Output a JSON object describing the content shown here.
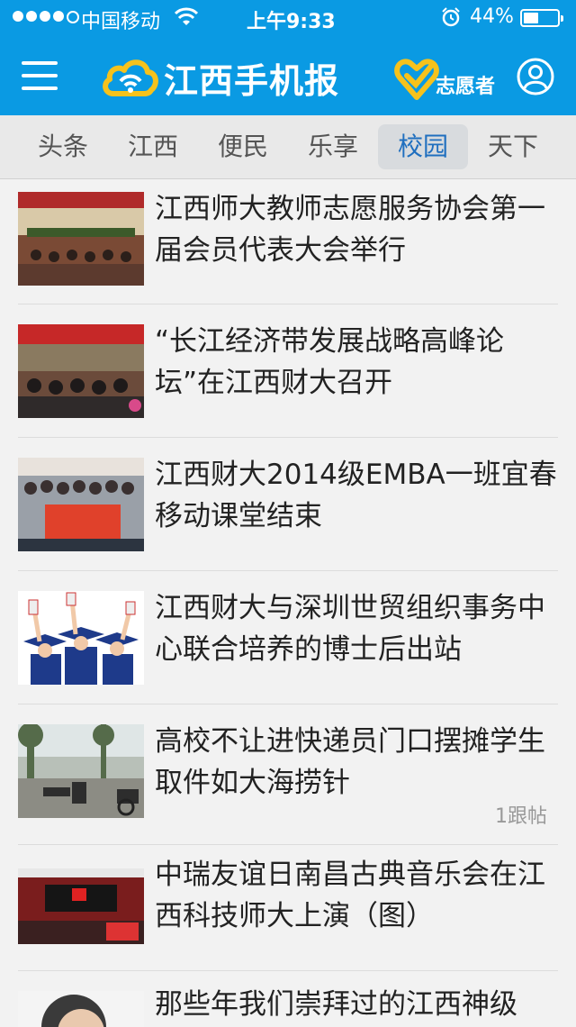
{
  "status_bar": {
    "carrier": "中国移动",
    "time": "上午9:33",
    "battery": "44%",
    "battery_level": 0.44,
    "signal_bars_filled": 4,
    "signal_bars_total": 5
  },
  "header": {
    "app_title": "江西手机报",
    "volunteer_label": "志愿者",
    "colors": {
      "brand": "#0a9ae3",
      "logo_yellow": "#f6c21c"
    }
  },
  "tabs": [
    {
      "label": "头条",
      "active": false
    },
    {
      "label": "江西",
      "active": false
    },
    {
      "label": "便民",
      "active": false
    },
    {
      "label": "乐享",
      "active": false
    },
    {
      "label": "校园",
      "active": true
    },
    {
      "label": "天下",
      "active": false
    }
  ],
  "news": [
    {
      "title": "江西师大教师志愿服务协会第一届会员代表大会举行",
      "thumb": "conference-hall-photo",
      "comments": ""
    },
    {
      "title": "“长江经济带发展战略高峰论坛”在江西财大召开",
      "thumb": "forum-meeting-photo",
      "comments": ""
    },
    {
      "title": "江西财大2014级EMBA一班宜春移动课堂结束",
      "thumb": "group-banner-photo",
      "comments": ""
    },
    {
      "title": "江西财大与深圳世贸组织事务中心联合培养的博士后出站",
      "thumb": "graduates-photo",
      "comments": ""
    },
    {
      "title": "高校不让进快递员门口摆摊学生取件如大海捞针",
      "thumb": "street-couriers-photo",
      "comments": "1跟帖"
    },
    {
      "title": "中瑞友谊日南昌古典音乐会在江西科技师大上演（图）",
      "thumb": "concert-stage-photo",
      "comments": ""
    },
    {
      "title": "那些年我们崇拜过的江西神级",
      "thumb": "portrait-photo",
      "comments": ""
    }
  ]
}
